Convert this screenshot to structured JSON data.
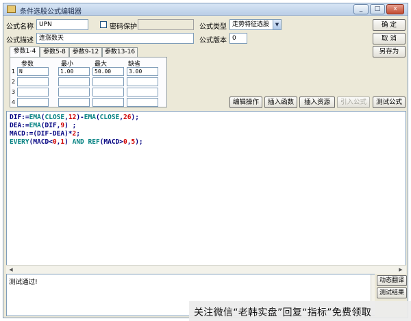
{
  "window": {
    "title": "条件选股公式编辑器",
    "minimize": "_",
    "maximize": "□",
    "close": "x"
  },
  "formula": {
    "name_label": "公式名称",
    "name_value": "UPN",
    "password_label": "密码保护",
    "password_checked": false,
    "password_value": "",
    "desc_label": "公式描述",
    "desc_value": "连涨数天",
    "type_label": "公式类型",
    "type_value": "走势特征选股",
    "version_label": "公式版本",
    "version_value": "0"
  },
  "buttons": {
    "ok": "确  定",
    "cancel": "取  消",
    "save_as": "另存为",
    "edit_ops": "编辑操作",
    "insert_func": "插入函数",
    "insert_res": "插入资源",
    "quote_formula": "引入公式",
    "test_formula": "测试公式",
    "dynamic_translate": "动态翻译",
    "test_result": "测试结果"
  },
  "tabs": [
    "参数1-4",
    "参数5-8",
    "参数9-12",
    "参数13-16"
  ],
  "params": {
    "headers": [
      "参数",
      "最小",
      "最大",
      "缺省"
    ],
    "rows": [
      {
        "num": "1",
        "name": "N",
        "min": "1.00",
        "max": "50.00",
        "def": "3.00"
      },
      {
        "num": "2",
        "name": "",
        "min": "",
        "max": "",
        "def": ""
      },
      {
        "num": "3",
        "name": "",
        "min": "",
        "max": "",
        "def": ""
      },
      {
        "num": "4",
        "name": "",
        "min": "",
        "max": "",
        "def": ""
      }
    ]
  },
  "code": [
    [
      {
        "t": "DIF:=",
        "c": "var"
      },
      {
        "t": "EMA",
        "c": "fn"
      },
      {
        "t": "(",
        "c": "op"
      },
      {
        "t": "CLOSE",
        "c": "fn"
      },
      {
        "t": ",",
        "c": "op"
      },
      {
        "t": "12",
        "c": "num"
      },
      {
        "t": ")-",
        "c": "op"
      },
      {
        "t": "EMA",
        "c": "fn"
      },
      {
        "t": "(",
        "c": "op"
      },
      {
        "t": "CLOSE",
        "c": "fn"
      },
      {
        "t": ",",
        "c": "op"
      },
      {
        "t": "26",
        "c": "num"
      },
      {
        "t": ");",
        "c": "op"
      }
    ],
    [
      {
        "t": "DEA:=",
        "c": "var"
      },
      {
        "t": "EMA",
        "c": "fn"
      },
      {
        "t": "(DIF,",
        "c": "op"
      },
      {
        "t": "9",
        "c": "num"
      },
      {
        "t": ") ;",
        "c": "op"
      }
    ],
    [
      {
        "t": "MACD:=",
        "c": "var"
      },
      {
        "t": "(DIF-DEA)*",
        "c": "op"
      },
      {
        "t": "2",
        "c": "num"
      },
      {
        "t": ";",
        "c": "op"
      }
    ],
    [
      {
        "t": "EVERY",
        "c": "fn"
      },
      {
        "t": "(MACD<",
        "c": "op"
      },
      {
        "t": "0",
        "c": "num"
      },
      {
        "t": ",",
        "c": "op"
      },
      {
        "t": "1",
        "c": "num"
      },
      {
        "t": ") ",
        "c": "op"
      },
      {
        "t": "AND",
        "c": "fn"
      },
      {
        "t": " ",
        "c": "op"
      },
      {
        "t": "REF",
        "c": "fn"
      },
      {
        "t": "(MACD>",
        "c": "op"
      },
      {
        "t": "0",
        "c": "num"
      },
      {
        "t": ",",
        "c": "op"
      },
      {
        "t": "5",
        "c": "num"
      },
      {
        "t": ");",
        "c": "op"
      }
    ]
  ],
  "code_colors": {
    "var": "#000080",
    "fn": "#008080",
    "op": "#000080",
    "num": "#d00000"
  },
  "status": {
    "message": "测试通过!"
  },
  "watermark": "关注微信“老韩实盘”回复“指标”免费领取"
}
